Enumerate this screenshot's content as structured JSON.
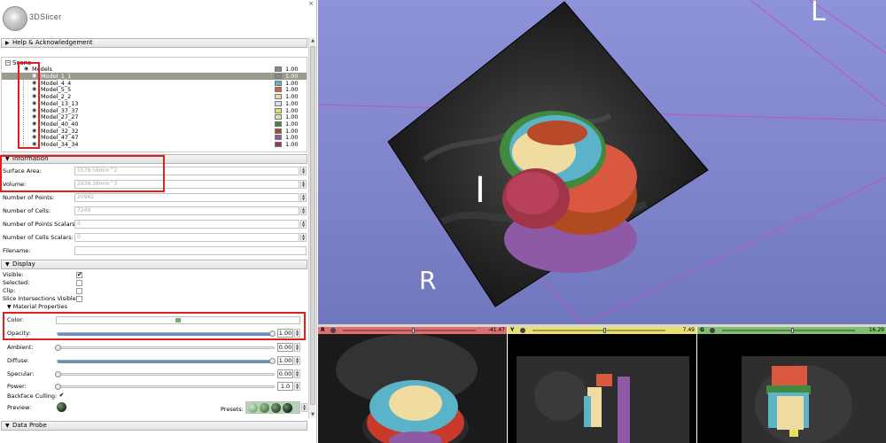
{
  "app": {
    "title": "3DSlicer",
    "close_glyph": "×"
  },
  "sections": {
    "help": "Help & Acknowledgement",
    "information": "Information",
    "display": "Display",
    "material": "Material Properties",
    "data_probe": "Data Probe"
  },
  "scene": {
    "label": "Scene",
    "models_label": "Models",
    "items": [
      {
        "name": "Model_1_1",
        "color": "#888888",
        "value": "1.00",
        "selected": true
      },
      {
        "name": "Model_4_4",
        "color": "#5bb3c9",
        "value": "1.00",
        "selected": false
      },
      {
        "name": "Model_5_5",
        "color": "#d9583f",
        "value": "1.00",
        "selected": false
      },
      {
        "name": "Model_2_2",
        "color": "#f0dca0",
        "value": "1.00",
        "selected": false
      },
      {
        "name": "Model_13_13",
        "color": "#cfe0ef",
        "value": "1.00",
        "selected": false
      },
      {
        "name": "Model_37_37",
        "color": "#e6e05a",
        "value": "1.00",
        "selected": false
      },
      {
        "name": "Model_27_27",
        "color": "#d8e6a0",
        "value": "1.00",
        "selected": false
      },
      {
        "name": "Model_40_40",
        "color": "#3f8a3f",
        "value": "1.00",
        "selected": false
      },
      {
        "name": "Model_32_32",
        "color": "#b04a20",
        "value": "1.00",
        "selected": false
      },
      {
        "name": "Model_47_47",
        "color": "#8e5aa5",
        "value": "1.00",
        "selected": false
      },
      {
        "name": "Model_34_34",
        "color": "#a0354a",
        "value": "1.00",
        "selected": false
      }
    ],
    "models_color": "#ffffff",
    "models_value": "1.00"
  },
  "information": {
    "surface_area_label": "Surface Area:",
    "surface_area_value": "5579.56mm^2",
    "volume_label": "Volume:",
    "volume_value": "2938.38mm^3",
    "num_points_label": "Number of Points:",
    "num_points_value": "20962",
    "num_cells_label": "Number of Cells:",
    "num_cells_value": "7249",
    "num_points_scalars_label": "Number of Points Scalars:",
    "num_points_scalars_value": "3",
    "num_cells_scalars_label": "Number of Cells Scalars:",
    "num_cells_scalars_value": "0",
    "filename_label": "Filename:",
    "filename_value": ""
  },
  "display": {
    "visible_label": "Visible:",
    "visible_checked": "✔",
    "selected_label": "Selected:",
    "clip_label": "Clip:",
    "slice_intersections_label": "Slice Intersections Visible:",
    "color_label": "Color:",
    "color_swatch": "#7aa87a",
    "opacity_label": "Opacity:",
    "opacity_value": "1.00",
    "ambient_label": "Ambient:",
    "ambient_value": "0.00",
    "diffuse_label": "Diffuse:",
    "diffuse_value": "1.00",
    "specular_label": "Specular:",
    "specular_value": "0.00",
    "power_label": "Power:",
    "power_value": "1.0",
    "backface_label": "Backface Culling:",
    "backface_checked": "✔",
    "preview_label": "Preview:",
    "presets_label": "Presets:"
  },
  "view3d": {
    "labels": {
      "left": "L",
      "inferior": "I",
      "right": "R"
    },
    "background": "#8186cc"
  },
  "slices": [
    {
      "letter": "R",
      "offset": "-41.47",
      "bar_color": "#e07070",
      "handle_pos": 0.48
    },
    {
      "letter": "Y",
      "offset": "7.49",
      "bar_color": "#e8e070",
      "handle_pos": 0.52
    },
    {
      "letter": "G",
      "offset": "16.29",
      "bar_color": "#80c070",
      "handle_pos": 0.5
    }
  ]
}
